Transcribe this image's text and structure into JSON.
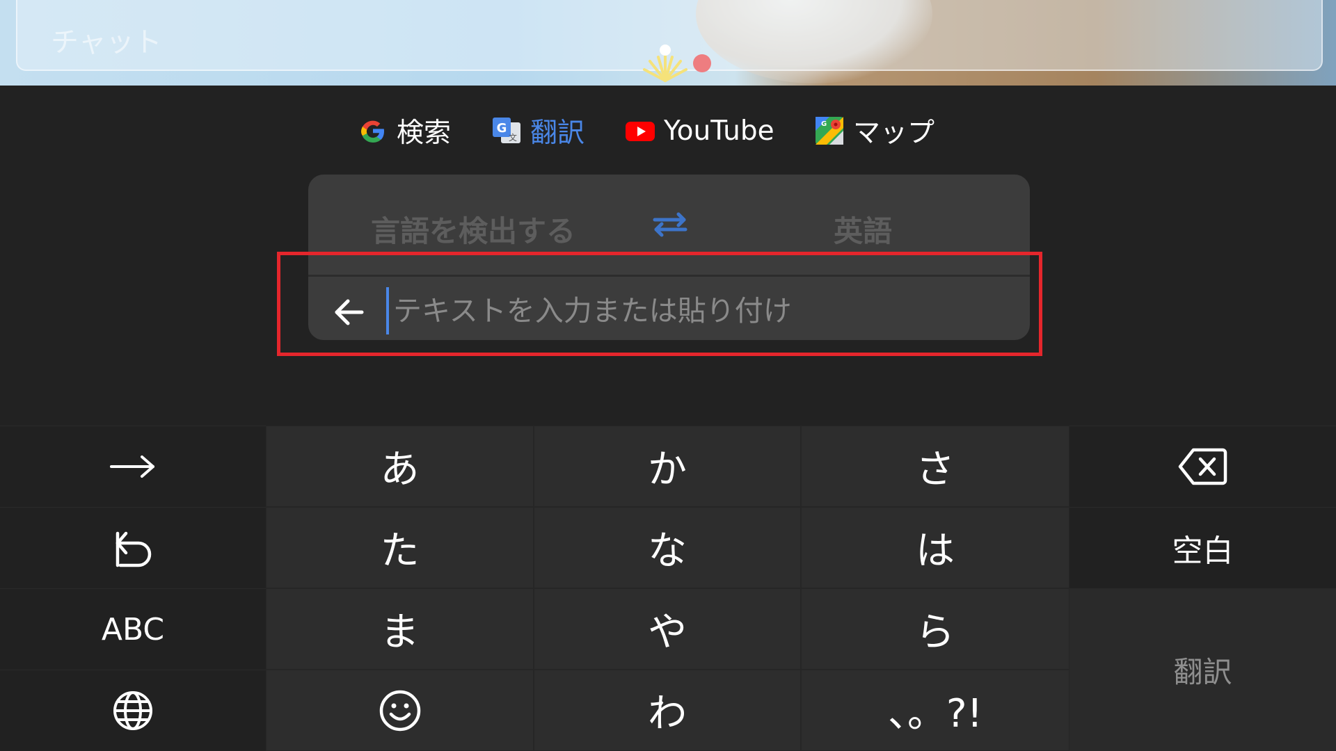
{
  "app": {
    "chat_placeholder": "チャット"
  },
  "shortcuts": {
    "search": {
      "label": "検索",
      "icon": "google-g-icon"
    },
    "translate": {
      "label": "翻訳",
      "icon": "google-translate-icon",
      "color": "#4a87e8"
    },
    "youtube": {
      "label": "YouTube",
      "icon": "youtube-icon"
    },
    "maps": {
      "label": "マップ",
      "icon": "google-maps-icon"
    }
  },
  "translate_panel": {
    "source_language": "言語を検出する",
    "target_language": "英語",
    "input_placeholder": "テキストを入力または貼り付け",
    "input_value": ""
  },
  "keyboard": {
    "kana_keys": [
      "あ",
      "か",
      "さ",
      "た",
      "な",
      "は",
      "ま",
      "や",
      "ら",
      "わ",
      "、。?!"
    ],
    "abc_label": "ABC",
    "space_label": "空白",
    "action_label": "翻訳"
  },
  "colors": {
    "highlight": "#e5262c",
    "accent_blue": "#4a87e8",
    "keyboard_bg": "#1f1f1f"
  }
}
